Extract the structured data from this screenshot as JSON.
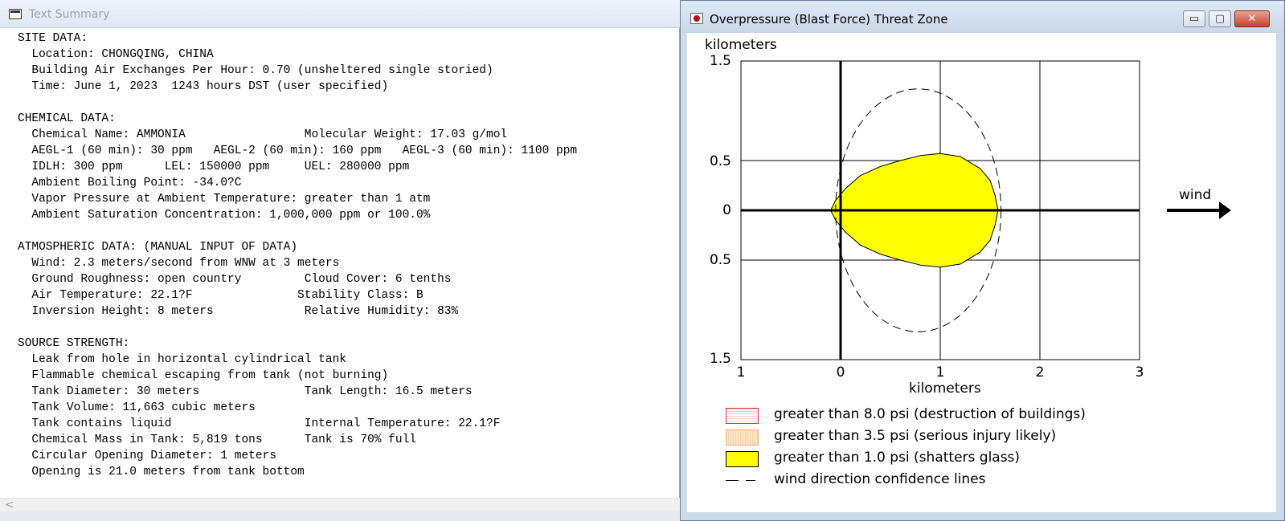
{
  "left_window": {
    "title": "Text Summary",
    "summary_text": "SITE DATA:\n  Location: CHONGQING, CHINA\n  Building Air Exchanges Per Hour: 0.70 (unsheltered single storied)\n  Time: June 1, 2023  1243 hours DST (user specified)\n\nCHEMICAL DATA:\n  Chemical Name: AMMONIA                 Molecular Weight: 17.03 g/mol\n  AEGL-1 (60 min): 30 ppm   AEGL-2 (60 min): 160 ppm   AEGL-3 (60 min): 1100 ppm\n  IDLH: 300 ppm      LEL: 150000 ppm     UEL: 280000 ppm\n  Ambient Boiling Point: -34.0?C\n  Vapor Pressure at Ambient Temperature: greater than 1 atm\n  Ambient Saturation Concentration: 1,000,000 ppm or 100.0%\n\nATMOSPHERIC DATA: (MANUAL INPUT OF DATA)\n  Wind: 2.3 meters/second from WNW at 3 meters\n  Ground Roughness: open country         Cloud Cover: 6 tenths\n  Air Temperature: 22.1?F               Stability Class: B\n  Inversion Height: 8 meters             Relative Humidity: 83%\n\nSOURCE STRENGTH:\n  Leak from hole in horizontal cylindrical tank\n  Flammable chemical escaping from tank (not burning)\n  Tank Diameter: 30 meters               Tank Length: 16.5 meters\n  Tank Volume: 11,663 cubic meters\n  Tank contains liquid                   Internal Temperature: 22.1?F\n  Chemical Mass in Tank: 5,819 tons      Tank is 70% full\n  Circular Opening Diameter: 1 meters\n  Opening is 21.0 meters from tank bottom",
    "scroll_left_glyph": "<"
  },
  "right_window": {
    "title": "Overpressure (Blast Force) Threat Zone",
    "buttons": {
      "minimize": "▭",
      "maximize": "▢",
      "close": "✕"
    },
    "y_axis_title": "kilometers",
    "x_axis_title": "kilometers",
    "y_tick_labels": [
      "1.5",
      "0.5",
      "0",
      "0.5",
      "1.5"
    ],
    "x_tick_labels": [
      "1",
      "0",
      "1",
      "2",
      "3"
    ],
    "wind_label": "wind",
    "legend": [
      {
        "label": "greater than 8.0 psi (destruction of buildings)",
        "color": "#e03030"
      },
      {
        "label": "greater than 3.5 psi (serious injury likely)",
        "color": "#f3b070"
      },
      {
        "label": "greater than 1.0 psi (shatters glass)",
        "color": "#ffff00"
      },
      {
        "label": "wind direction confidence lines",
        "color": "#000000"
      }
    ]
  },
  "chart_data": {
    "type": "area",
    "x_range": [
      -1,
      3
    ],
    "y_range": [
      -1.5,
      1.5
    ],
    "grid": true,
    "series": [
      {
        "name": "greater than 1.0 psi (shatters glass)",
        "color": "#ffff00",
        "points": [
          [
            -0.1,
            0
          ],
          [
            -0.05,
            0.1
          ],
          [
            0.05,
            0.22
          ],
          [
            0.2,
            0.35
          ],
          [
            0.4,
            0.44
          ],
          [
            0.6,
            0.5
          ],
          [
            0.8,
            0.55
          ],
          [
            1.0,
            0.57
          ],
          [
            1.2,
            0.54
          ],
          [
            1.4,
            0.42
          ],
          [
            1.5,
            0.3
          ],
          [
            1.55,
            0.15
          ],
          [
            1.58,
            0
          ],
          [
            1.55,
            -0.15
          ],
          [
            1.5,
            -0.3
          ],
          [
            1.4,
            -0.42
          ],
          [
            1.2,
            -0.54
          ],
          [
            1.0,
            -0.57
          ],
          [
            0.8,
            -0.55
          ],
          [
            0.6,
            -0.5
          ],
          [
            0.4,
            -0.44
          ],
          [
            0.2,
            -0.35
          ],
          [
            0.05,
            -0.22
          ],
          [
            -0.05,
            -0.1
          ]
        ]
      },
      {
        "name": "wind direction confidence lines",
        "color": "#000000",
        "ellipse": {
          "cx": 0.78,
          "cy": 0,
          "rx": 0.83,
          "ry": 1.22
        }
      }
    ]
  }
}
